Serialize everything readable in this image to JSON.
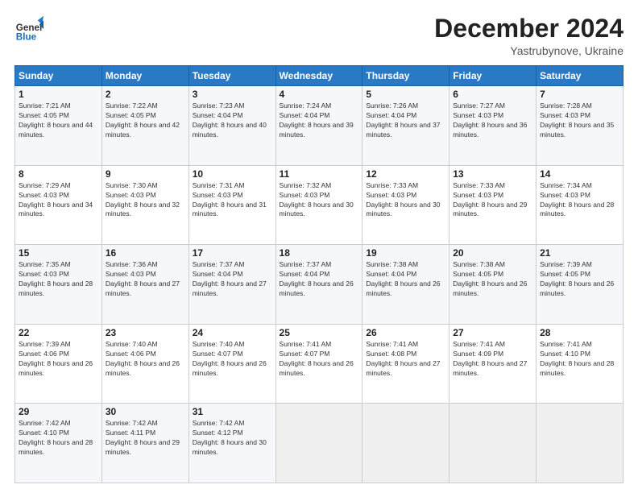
{
  "header": {
    "logo_line1": "General",
    "logo_line2": "Blue",
    "month": "December 2024",
    "location": "Yastrubynove, Ukraine"
  },
  "weekdays": [
    "Sunday",
    "Monday",
    "Tuesday",
    "Wednesday",
    "Thursday",
    "Friday",
    "Saturday"
  ],
  "weeks": [
    [
      {
        "day": "1",
        "sunrise": "7:21 AM",
        "sunset": "4:05 PM",
        "daylight": "8 hours and 44 minutes."
      },
      {
        "day": "2",
        "sunrise": "7:22 AM",
        "sunset": "4:05 PM",
        "daylight": "8 hours and 42 minutes."
      },
      {
        "day": "3",
        "sunrise": "7:23 AM",
        "sunset": "4:04 PM",
        "daylight": "8 hours and 40 minutes."
      },
      {
        "day": "4",
        "sunrise": "7:24 AM",
        "sunset": "4:04 PM",
        "daylight": "8 hours and 39 minutes."
      },
      {
        "day": "5",
        "sunrise": "7:26 AM",
        "sunset": "4:04 PM",
        "daylight": "8 hours and 37 minutes."
      },
      {
        "day": "6",
        "sunrise": "7:27 AM",
        "sunset": "4:03 PM",
        "daylight": "8 hours and 36 minutes."
      },
      {
        "day": "7",
        "sunrise": "7:28 AM",
        "sunset": "4:03 PM",
        "daylight": "8 hours and 35 minutes."
      }
    ],
    [
      {
        "day": "8",
        "sunrise": "7:29 AM",
        "sunset": "4:03 PM",
        "daylight": "8 hours and 34 minutes."
      },
      {
        "day": "9",
        "sunrise": "7:30 AM",
        "sunset": "4:03 PM",
        "daylight": "8 hours and 32 minutes."
      },
      {
        "day": "10",
        "sunrise": "7:31 AM",
        "sunset": "4:03 PM",
        "daylight": "8 hours and 31 minutes."
      },
      {
        "day": "11",
        "sunrise": "7:32 AM",
        "sunset": "4:03 PM",
        "daylight": "8 hours and 30 minutes."
      },
      {
        "day": "12",
        "sunrise": "7:33 AM",
        "sunset": "4:03 PM",
        "daylight": "8 hours and 30 minutes."
      },
      {
        "day": "13",
        "sunrise": "7:33 AM",
        "sunset": "4:03 PM",
        "daylight": "8 hours and 29 minutes."
      },
      {
        "day": "14",
        "sunrise": "7:34 AM",
        "sunset": "4:03 PM",
        "daylight": "8 hours and 28 minutes."
      }
    ],
    [
      {
        "day": "15",
        "sunrise": "7:35 AM",
        "sunset": "4:03 PM",
        "daylight": "8 hours and 28 minutes."
      },
      {
        "day": "16",
        "sunrise": "7:36 AM",
        "sunset": "4:03 PM",
        "daylight": "8 hours and 27 minutes."
      },
      {
        "day": "17",
        "sunrise": "7:37 AM",
        "sunset": "4:04 PM",
        "daylight": "8 hours and 27 minutes."
      },
      {
        "day": "18",
        "sunrise": "7:37 AM",
        "sunset": "4:04 PM",
        "daylight": "8 hours and 26 minutes."
      },
      {
        "day": "19",
        "sunrise": "7:38 AM",
        "sunset": "4:04 PM",
        "daylight": "8 hours and 26 minutes."
      },
      {
        "day": "20",
        "sunrise": "7:38 AM",
        "sunset": "4:05 PM",
        "daylight": "8 hours and 26 minutes."
      },
      {
        "day": "21",
        "sunrise": "7:39 AM",
        "sunset": "4:05 PM",
        "daylight": "8 hours and 26 minutes."
      }
    ],
    [
      {
        "day": "22",
        "sunrise": "7:39 AM",
        "sunset": "4:06 PM",
        "daylight": "8 hours and 26 minutes."
      },
      {
        "day": "23",
        "sunrise": "7:40 AM",
        "sunset": "4:06 PM",
        "daylight": "8 hours and 26 minutes."
      },
      {
        "day": "24",
        "sunrise": "7:40 AM",
        "sunset": "4:07 PM",
        "daylight": "8 hours and 26 minutes."
      },
      {
        "day": "25",
        "sunrise": "7:41 AM",
        "sunset": "4:07 PM",
        "daylight": "8 hours and 26 minutes."
      },
      {
        "day": "26",
        "sunrise": "7:41 AM",
        "sunset": "4:08 PM",
        "daylight": "8 hours and 27 minutes."
      },
      {
        "day": "27",
        "sunrise": "7:41 AM",
        "sunset": "4:09 PM",
        "daylight": "8 hours and 27 minutes."
      },
      {
        "day": "28",
        "sunrise": "7:41 AM",
        "sunset": "4:10 PM",
        "daylight": "8 hours and 28 minutes."
      }
    ],
    [
      {
        "day": "29",
        "sunrise": "7:42 AM",
        "sunset": "4:10 PM",
        "daylight": "8 hours and 28 minutes."
      },
      {
        "day": "30",
        "sunrise": "7:42 AM",
        "sunset": "4:11 PM",
        "daylight": "8 hours and 29 minutes."
      },
      {
        "day": "31",
        "sunrise": "7:42 AM",
        "sunset": "4:12 PM",
        "daylight": "8 hours and 30 minutes."
      },
      null,
      null,
      null,
      null
    ]
  ]
}
